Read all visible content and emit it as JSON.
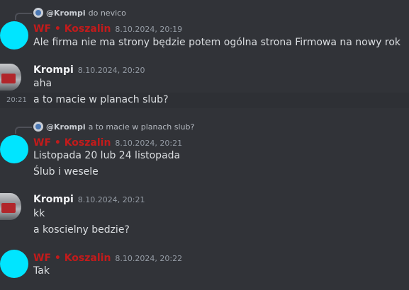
{
  "messages": [
    {
      "reply": {
        "name": "@Krompi",
        "text": "do nevico"
      },
      "author": "WF • Koszalin",
      "time": "8.10.2024, 20:19",
      "lines": [
        "Ale firma nie ma strony będzie potem ogólna strona Firmowa na nowy rok"
      ]
    },
    {
      "author": "Krompi",
      "time": "8.10.2024, 20:20",
      "lines": [
        "aha",
        "a to macie w planach slub?"
      ],
      "side_time": "20:21"
    },
    {
      "reply": {
        "name": "@Krompi",
        "text": "a to macie w planach slub?"
      },
      "author": "WF • Koszalin",
      "time": "8.10.2024, 20:21",
      "lines": [
        "Listopada 20 lub 24 listopada",
        "Ślub i wesele"
      ]
    },
    {
      "author": "Krompi",
      "time": "8.10.2024, 20:21",
      "lines": [
        "kk",
        "a koscielny bedzie?"
      ]
    },
    {
      "author": "WF • Koszalin",
      "time": "8.10.2024, 20:22",
      "lines": [
        "Tak"
      ]
    }
  ],
  "colors": {
    "background": "#313338",
    "red_username": "#c21b1b",
    "avatar_cyan": "#00e5ff"
  },
  "icons": {
    "reply_avatar": "user-avatar-icon"
  }
}
